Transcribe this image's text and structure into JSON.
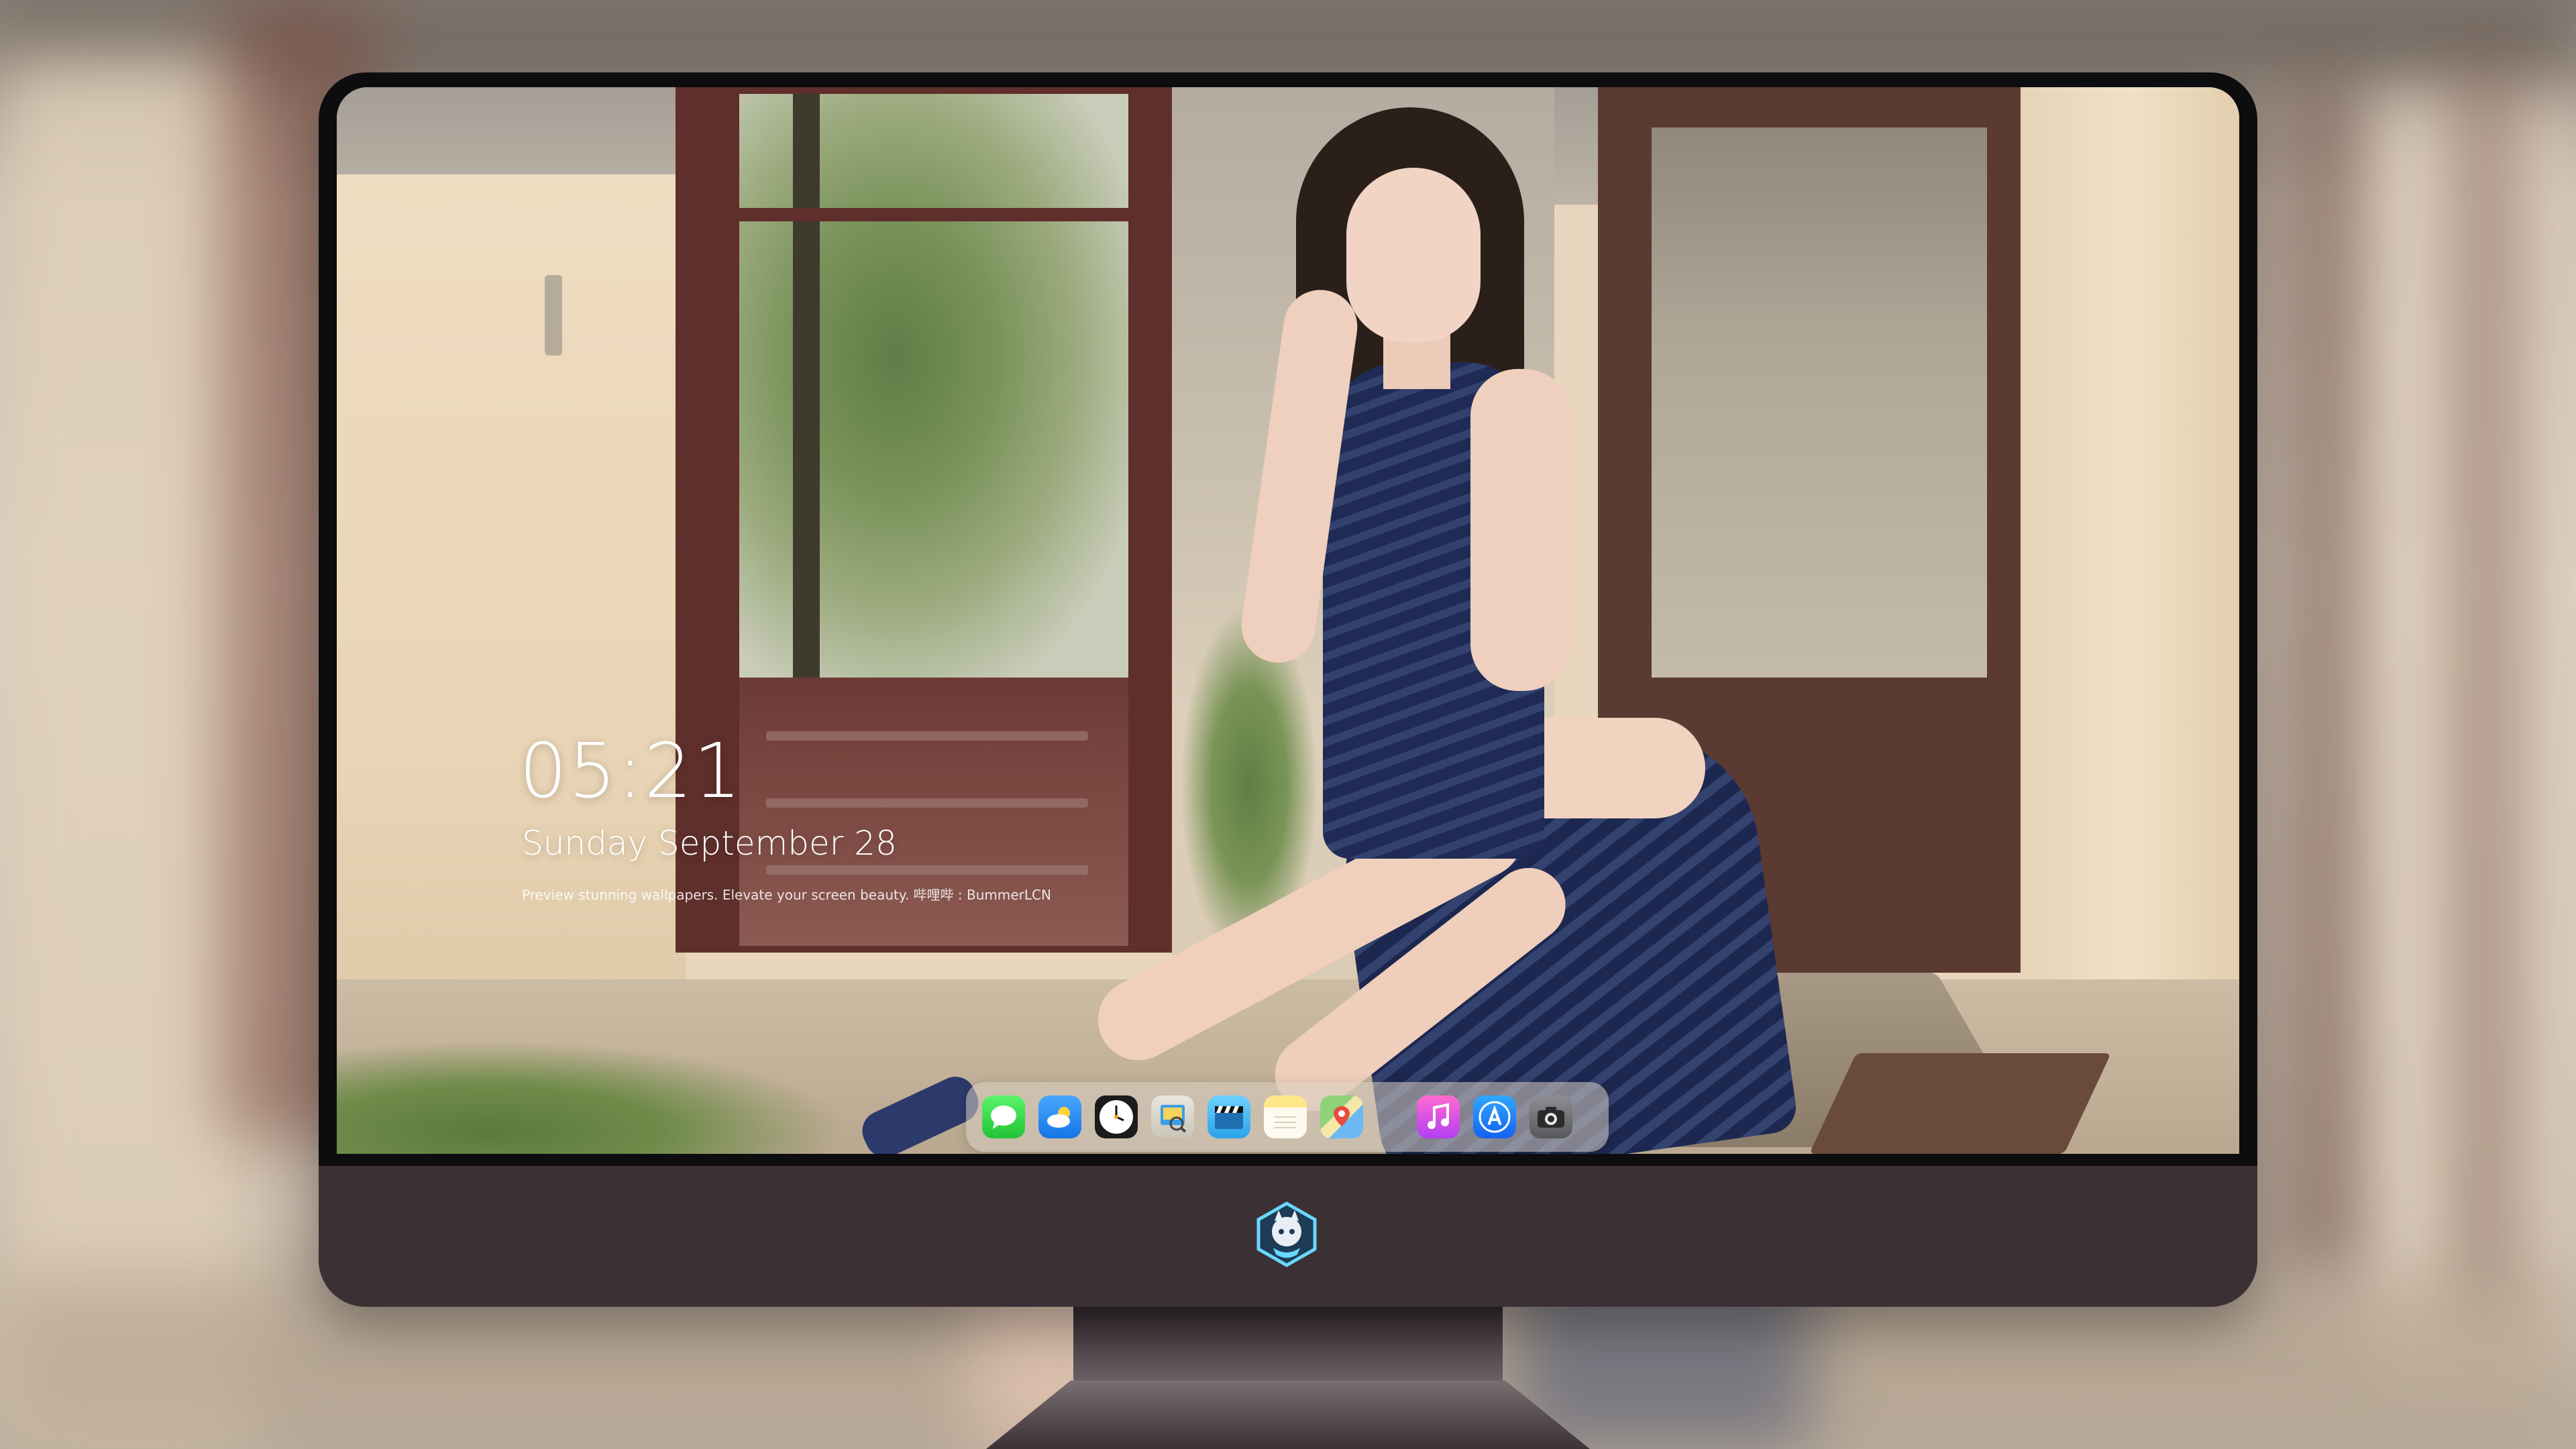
{
  "lockscreen": {
    "time": "05:21",
    "date": "Sunday September  28",
    "tagline": "Preview stunning wallpapers. Elevate your screen beauty. 哔哩哔 : BummerLCN"
  },
  "dock": {
    "apps": [
      {
        "name": "Messages",
        "icon": "messages-icon"
      },
      {
        "name": "Weather",
        "icon": "weather-icon"
      },
      {
        "name": "Clock",
        "icon": "clock-icon"
      },
      {
        "name": "Preview",
        "icon": "preview-icon"
      },
      {
        "name": "Clips",
        "icon": "clapperboard-icon"
      },
      {
        "name": "Notes",
        "icon": "notes-icon"
      },
      {
        "name": "Maps",
        "icon": "maps-icon"
      },
      {
        "name": "Music",
        "icon": "music-note-icon"
      },
      {
        "name": "App Store",
        "icon": "app-store-icon"
      },
      {
        "name": "Camera",
        "icon": "camera-icon"
      }
    ]
  },
  "colors": {
    "bezel": "#0d0d0f",
    "chin": "#3b3034",
    "clock_text": "#ffffff",
    "dock_bg": "rgba(215,205,195,0.55)"
  }
}
